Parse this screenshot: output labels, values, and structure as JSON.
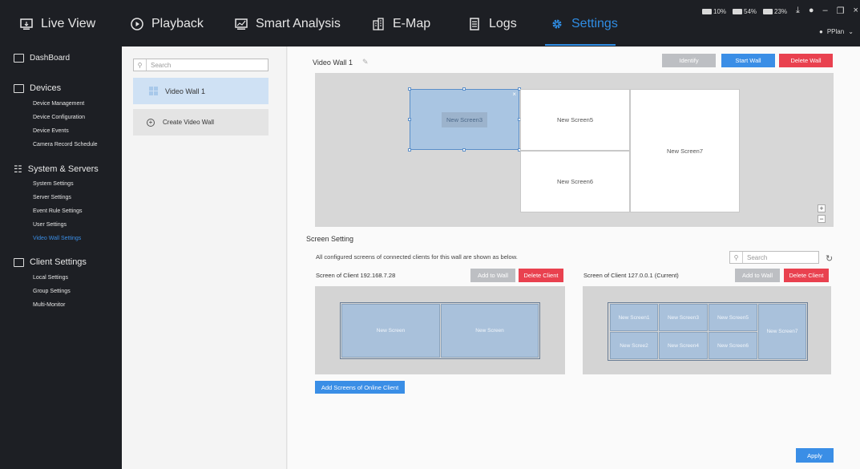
{
  "top_tabs": [
    {
      "label": "Live View",
      "icon": "monitor-icon"
    },
    {
      "label": "Playback",
      "icon": "play-circle-icon"
    },
    {
      "label": "Smart Analysis",
      "icon": "chart-screen-icon"
    },
    {
      "label": "E-Map",
      "icon": "building-map-icon"
    },
    {
      "label": "Logs",
      "icon": "logs-icon"
    },
    {
      "label": "Settings",
      "icon": "gear-icon"
    }
  ],
  "active_tab": "Settings",
  "accent_color": "#2f8de4",
  "danger_color": "#e9414f",
  "stats": [
    {
      "value": "10%"
    },
    {
      "value": "54%"
    },
    {
      "value": "23%"
    }
  ],
  "user": {
    "name": "PPlan"
  },
  "sidebar": {
    "dashboard": "DashBoard",
    "devices": {
      "label": "Devices",
      "items": [
        "Device Management",
        "Device Configuration",
        "Device Events",
        "Camera Record Schedule"
      ]
    },
    "system": {
      "label": "System & Servers",
      "items": [
        "System Settings",
        "Server Settings",
        "Event Rule Settings",
        "User Settings",
        "Video Wall Settings"
      ]
    },
    "client": {
      "label": "Client Settings",
      "items": [
        "Local Settings",
        "Group Settings",
        "Multi-Monitor"
      ]
    },
    "active_item": "Video Wall Settings"
  },
  "list_panel": {
    "search_placeholder": "Search",
    "walls": [
      "Video Wall 1"
    ],
    "create_label": "Create Video Wall"
  },
  "wall": {
    "title": "Video Wall 1",
    "identify": "Identify",
    "start": "Start Wall",
    "delete": "Delete Wall",
    "screens": [
      "New Screen3",
      "New Screen5",
      "New Screen6",
      "New Screen7"
    ],
    "zoom_in": "+",
    "zoom_out": "−"
  },
  "screen_setting": {
    "title": "Screen Setting",
    "description": "All configured screens of connected clients for this wall are shown as below.",
    "search_placeholder": "Search",
    "client1": {
      "title": "Screen of Client 192.168.7.28",
      "add": "Add to Wall",
      "delete": "Delete Client",
      "screens": [
        "New Screen",
        "New Screen"
      ]
    },
    "client2": {
      "title": "Screen of Client 127.0.0.1 (Current)",
      "add": "Add to Wall",
      "delete": "Delete Client",
      "screens": [
        "New Screen1",
        "New Screen3",
        "New Screen5",
        "New Screen7",
        "New Scree2",
        "New Screen4",
        "New Screen6"
      ]
    },
    "add_online": "Add Screens of Online Client"
  },
  "apply": "Apply"
}
